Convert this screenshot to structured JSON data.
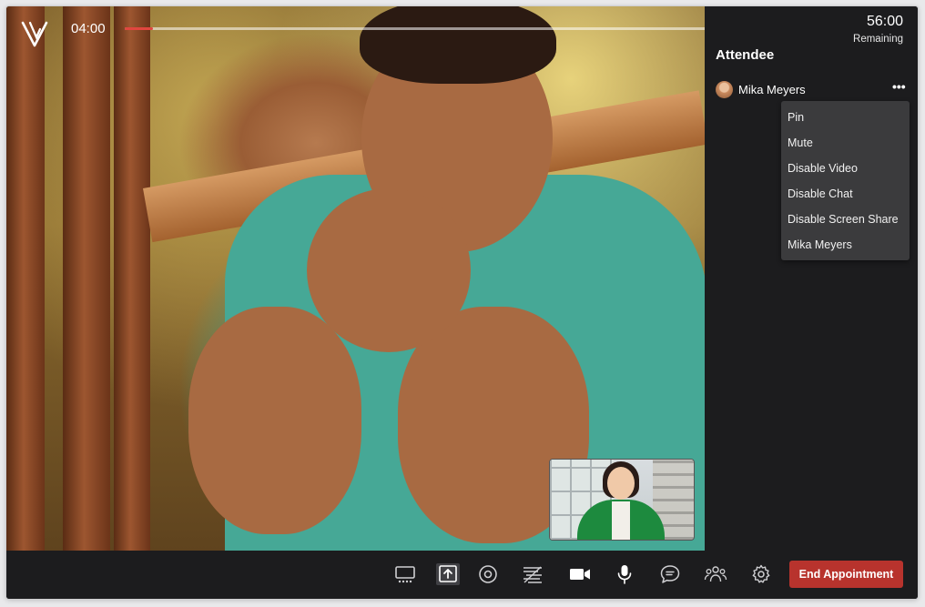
{
  "call": {
    "elapsed": "04:00",
    "progress_percent": 4,
    "remaining_time": "56:00",
    "remaining_label": "Remaining"
  },
  "sidebar": {
    "title": "Attendee",
    "attendees": [
      {
        "name": "Mika Meyers"
      }
    ],
    "menu": {
      "items": [
        {
          "label": "Pin"
        },
        {
          "label": "Mute"
        },
        {
          "label": "Disable Video"
        },
        {
          "label": "Disable Chat"
        },
        {
          "label": "Disable Screen Share"
        },
        {
          "label": "Mika Meyers"
        }
      ]
    }
  },
  "toolbar": {
    "icons": [
      "layout-icon",
      "screen-share-icon",
      "record-icon",
      "background-blur-icon",
      "camera-icon",
      "microphone-icon",
      "chat-icon",
      "participants-icon",
      "settings-icon"
    ],
    "end_label": "End Appointment"
  },
  "colors": {
    "accent_red": "#b8332d",
    "progress_red": "#e0463f",
    "panel_bg": "#1c1c1e",
    "menu_bg": "#3b3b3d"
  }
}
